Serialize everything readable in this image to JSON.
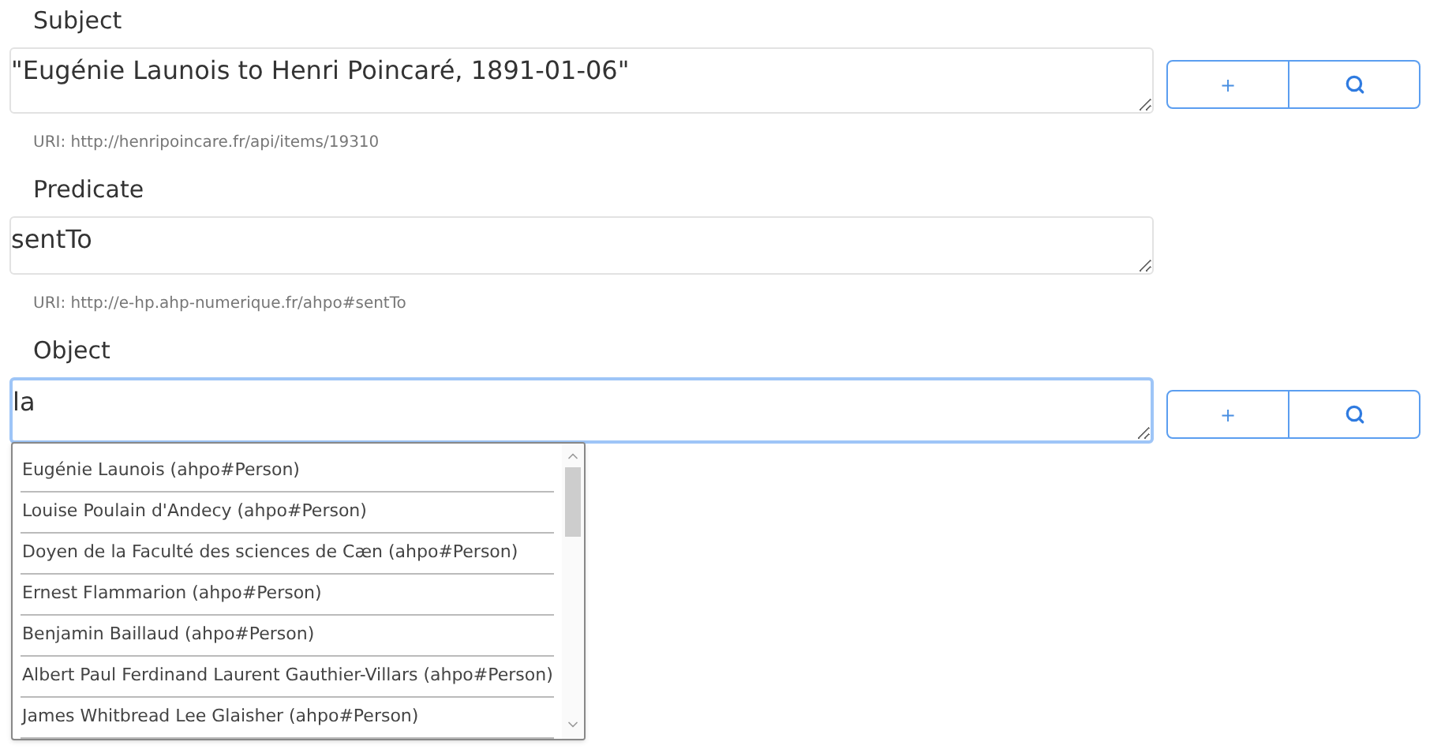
{
  "fields": [
    {
      "label": "Subject",
      "value": "\"Eugénie Launois to Henri Poincaré, 1891-01-06\"",
      "focused": false,
      "uri": "URI: http://henripoincare.fr/api/items/19310",
      "buttons": {
        "add": "+"
      }
    },
    {
      "label": "Predicate",
      "value": "sentTo",
      "focused": false,
      "uri": "URI: http://e-hp.ahp-numerique.fr/ahpo#sentTo"
    },
    {
      "label": "Object",
      "value": "la",
      "focused": true,
      "buttons": {
        "add": "+"
      },
      "suggestions": [
        "Eugénie Launois (ahpo#Person)",
        "Louise Poulain d'Andecy (ahpo#Person)",
        "Doyen de la Faculté des sciences de Cæn (ahpo#Person)",
        "Ernest Flammarion (ahpo#Person)",
        "Benjamin Baillaud (ahpo#Person)",
        "Albert Paul Ferdinand Laurent Gauthier-Villars (ahpo#Person)",
        "James Whitbread Lee Glaisher (ahpo#Person)"
      ]
    }
  ]
}
